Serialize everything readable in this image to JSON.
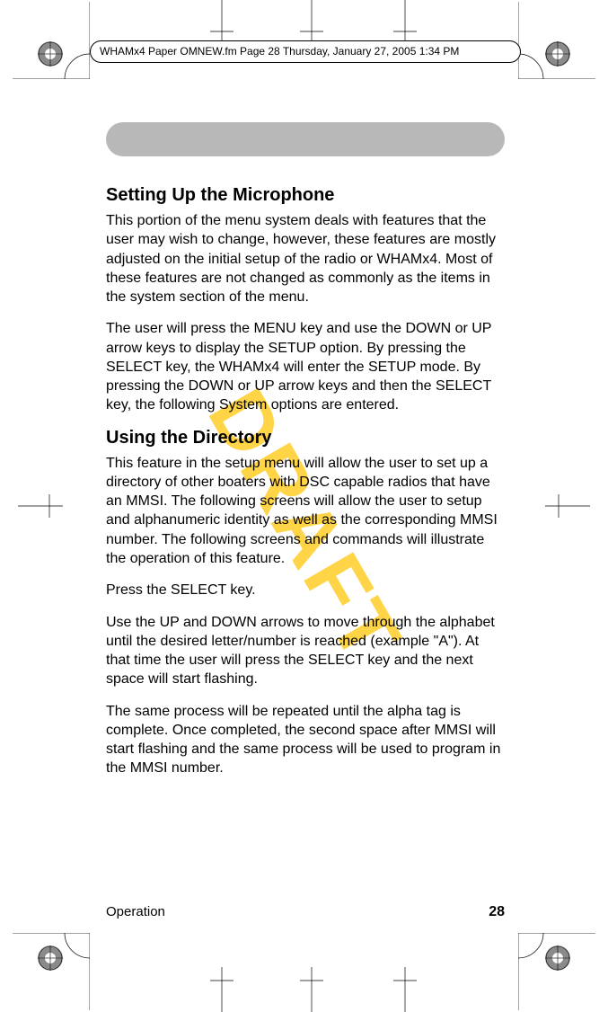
{
  "meta": {
    "header_line": "WHAMx4 Paper OMNEW.fm  Page 28  Thursday, January 27, 2005  1:34 PM"
  },
  "watermark": "DRAFT",
  "sections": {
    "mic_title": "Setting Up the Microphone",
    "mic_p1": "This portion of the menu system deals with features that the user may wish to change, however, these features are mostly adjusted on the initial setup of the radio or WHAMx4.  Most of these features are not changed as commonly as the items in the sys­tem section of the menu.",
    "mic_p2": "The user will press the MENU key and use the DOWN or UP arrow keys to display the SETUP option. By pressing the SELECT key, the WHAMx4 will enter the SETUP mode. By pressing the DOWN or UP arrow keys and then the SELECT key, the fol­lowing System options are entered.",
    "dir_title": "Using the Directory",
    "dir_p1": "This feature in the setup menu will allow the user to set up a directory of other boaters with DSC capable radios that have an MMSI.  The following screens will allow the user to setup and alphanumeric iden­tity as well as the corresponding MMSI number.  The following screens and commands will illustrate the operation of this feature.",
    "dir_p2": "Press the SELECT key.",
    "dir_p3": "Use the UP and DOWN arrows to move through the alphabet until the desired letter/number is reached (example \"A\").  At that time the user will press the SELECT key and the next space will start flashing.",
    "dir_p4": "The same process will be repeated until the alpha tag is complete.  Once completed, the second space after MMSI will start flashing and the same process will be used to program in the MMSI num­ber."
  },
  "footer": {
    "section": "Operation",
    "page": "28"
  }
}
